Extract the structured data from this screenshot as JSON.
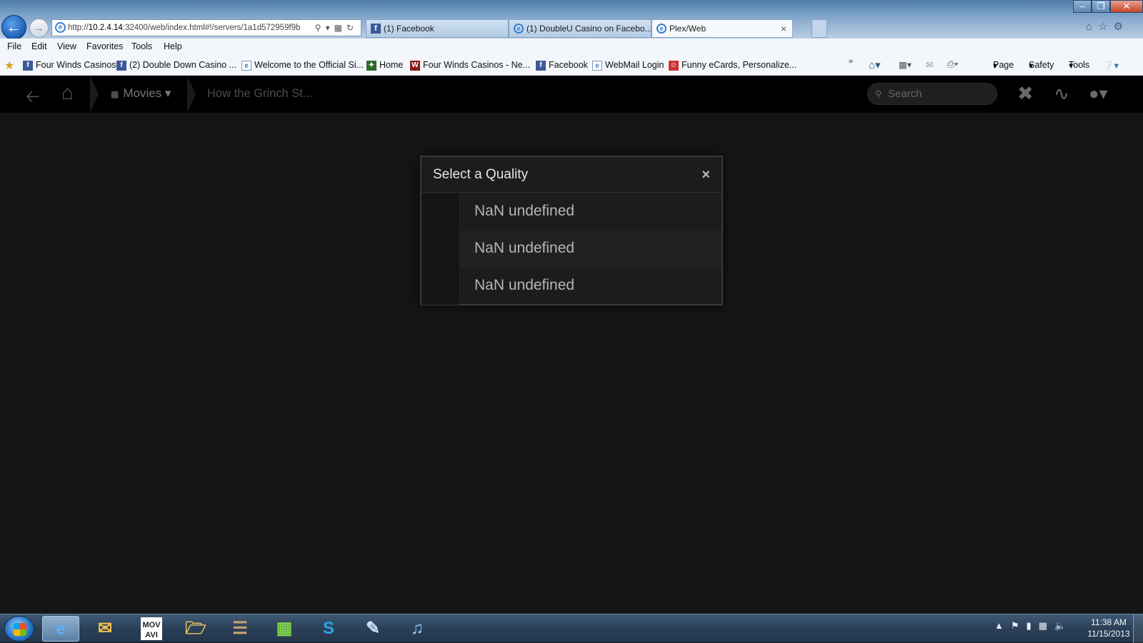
{
  "browser": {
    "address": {
      "host_bold": "10.2.4.14",
      "rest": ":32400/web/index.html#!/servers/1a1d572959f9b"
    },
    "address_prefix": "http://",
    "tabs": [
      {
        "label": "(1) Facebook",
        "icon": "facebook-icon"
      },
      {
        "label": "(1) DoubleU Casino on Facebo...",
        "icon": "ie-page-icon"
      },
      {
        "label": "Plex/Web",
        "icon": "ie-page-icon",
        "active": true
      }
    ],
    "tab_close": "×",
    "menu": [
      "File",
      "Edit",
      "View",
      "Favorites",
      "Tools",
      "Help"
    ],
    "favorites": [
      {
        "label": "Four Winds Casinos",
        "icon": "facebook-icon"
      },
      {
        "label": "(2) Double Down Casino ...",
        "icon": "facebook-icon"
      },
      {
        "label": "Welcome to the Official Si...",
        "icon": "ie-page-icon"
      },
      {
        "label": "Home",
        "icon": "green-page-icon"
      },
      {
        "label": "Four Winds Casinos - Ne...",
        "icon": "fourwinds-icon"
      },
      {
        "label": "Facebook",
        "icon": "facebook-icon"
      },
      {
        "label": "WebMail Login",
        "icon": "ie-page-icon"
      },
      {
        "label": "Funny eCards, Personalize...",
        "icon": "ecard-icon"
      }
    ],
    "command_bar": {
      "page": "Page",
      "safety": "Safety",
      "tools": "Tools"
    }
  },
  "plex": {
    "section": "Movies",
    "breadcrumb_title": "How the Grinch St...",
    "search_placeholder": "Search",
    "modal": {
      "title": "Select a Quality",
      "close": "×",
      "options": [
        "NaN undefined",
        "NaN undefined",
        "NaN undefined"
      ]
    }
  },
  "taskbar": {
    "apps": [
      "internet-explorer-icon",
      "outlook-icon",
      "mov-avi-converter-icon",
      "file-explorer-icon",
      "library-icon",
      "green-app-icon",
      "skype-icon",
      "pen-tool-icon",
      "itunes-icon"
    ],
    "mov_label_top": "MOV",
    "mov_label_bottom": "AVI",
    "clock_time": "11:38 AM",
    "clock_date": "11/15/2013"
  },
  "colors": {
    "plex_bg": "#151515",
    "nav_bg": "#000000",
    "modal_bg": "#1c1c1c",
    "ie_blue": "#1a5fb4"
  }
}
